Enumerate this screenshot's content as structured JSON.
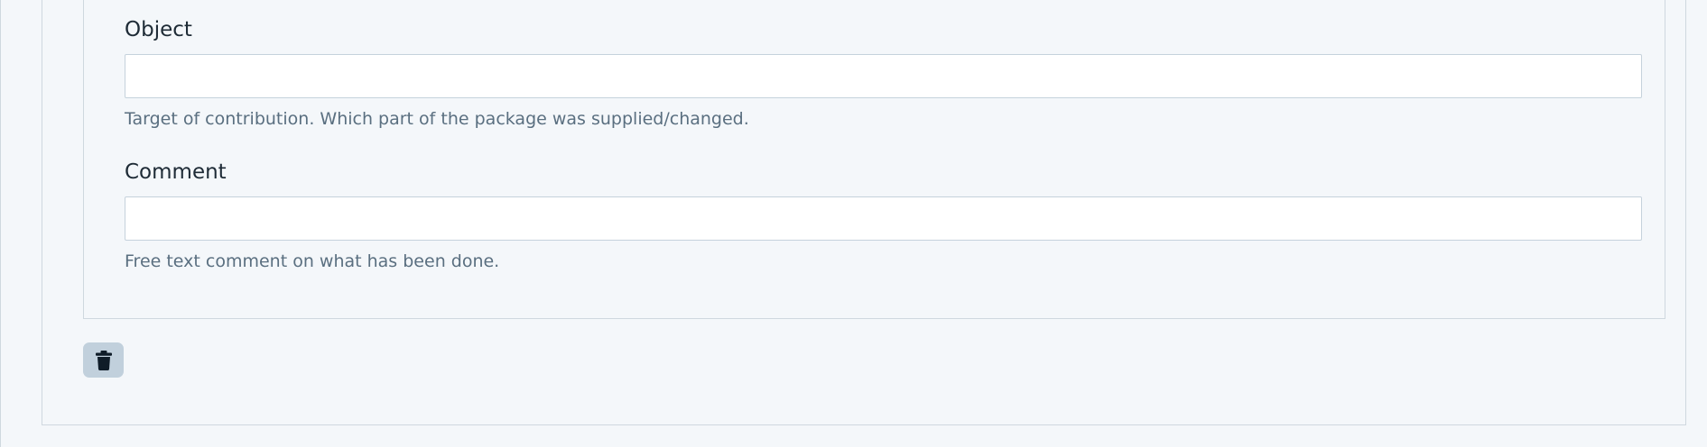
{
  "fields": [
    {
      "label": "Object",
      "value": "",
      "placeholder": "",
      "help": "Target of contribution. Which part of the package was supplied/changed."
    },
    {
      "label": "Comment",
      "value": "",
      "placeholder": "",
      "help": "Free text comment on what has been done."
    }
  ],
  "actions": {
    "delete_icon": "trash-icon"
  },
  "colors": {
    "background": "#f4f7fa",
    "border": "#cfd8df",
    "label_text": "#1e2b36",
    "help_text": "#5a6f80",
    "delete_button_bg": "#c1d0dc",
    "delete_icon": "#0f1c28"
  }
}
